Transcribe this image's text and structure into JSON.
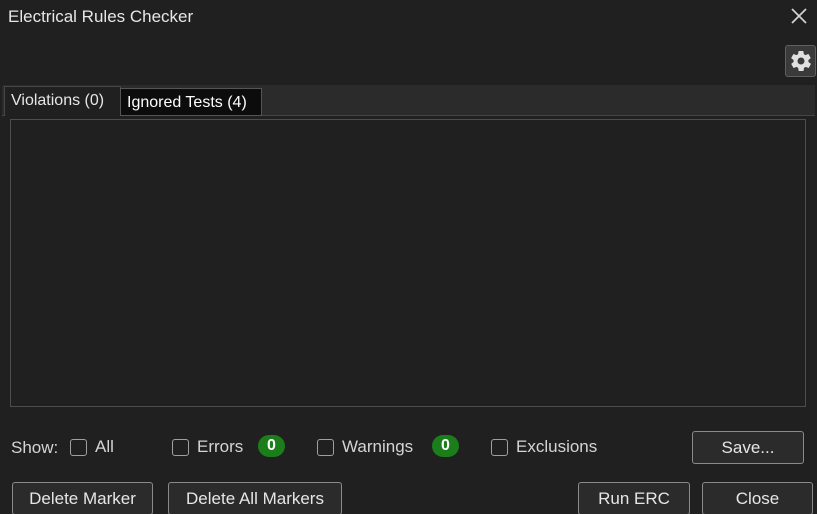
{
  "window": {
    "title": "Electrical Rules Checker"
  },
  "icons": {
    "close": "close-icon",
    "settings": "gear-icon"
  },
  "tabs": [
    {
      "label": "Violations (0)",
      "active": true
    },
    {
      "label": "Ignored Tests (4)",
      "active": false
    }
  ],
  "filters": {
    "show_label": "Show:",
    "all": {
      "label": "All",
      "checked": false
    },
    "errors": {
      "label": "Errors",
      "checked": false,
      "count": "0"
    },
    "warnings": {
      "label": "Warnings",
      "checked": false,
      "count": "0"
    },
    "exclusions": {
      "label": "Exclusions",
      "checked": false
    }
  },
  "buttons": {
    "save": "Save...",
    "delete_marker": "Delete Marker",
    "delete_all_markers": "Delete All Markers",
    "run_erc": "Run ERC",
    "close": "Close"
  },
  "colors": {
    "background": "#202020",
    "badge_green": "#1b7e1b",
    "inactive_tab": "#0c0c0c"
  }
}
